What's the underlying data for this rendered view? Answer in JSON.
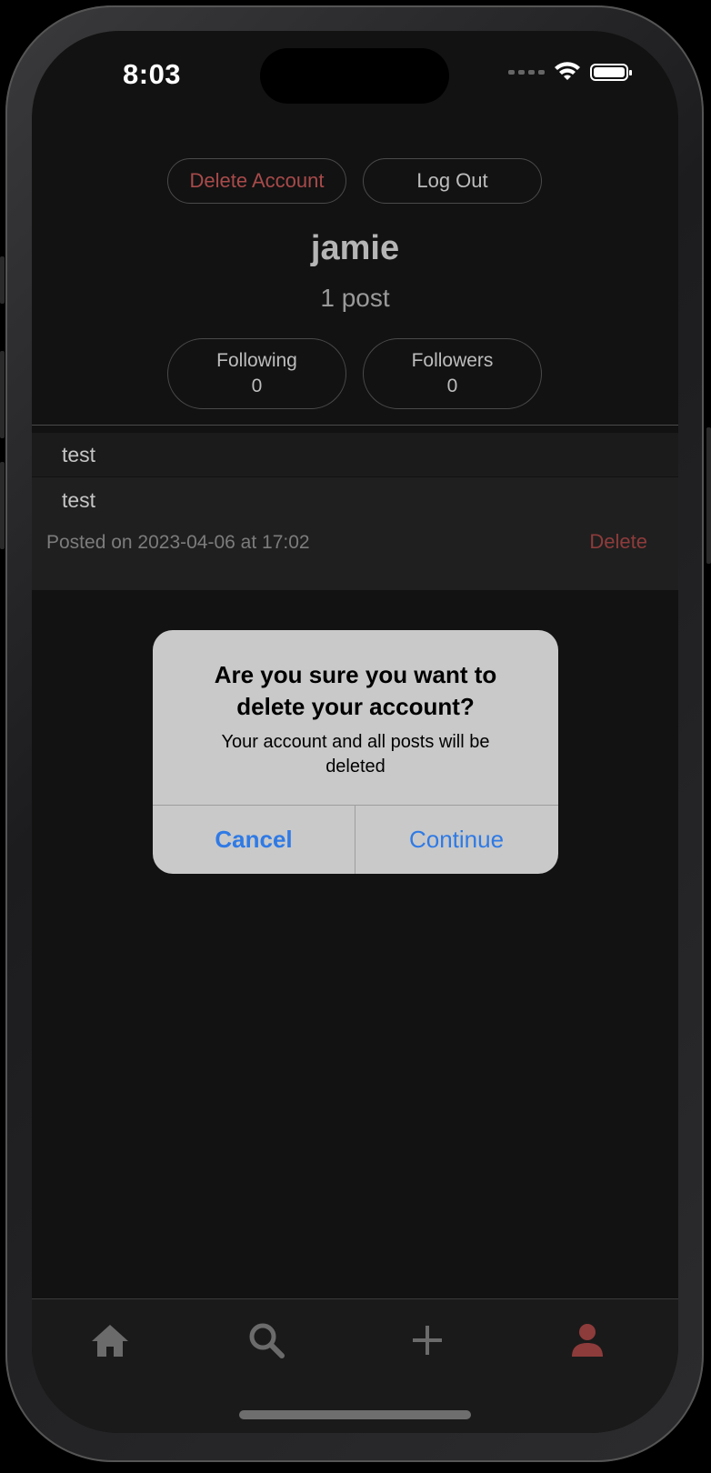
{
  "status_bar": {
    "time": "8:03"
  },
  "header": {
    "delete_account_label": "Delete Account",
    "log_out_label": "Log Out",
    "username": "jamie",
    "post_count": "1 post"
  },
  "stats": {
    "following_label": "Following",
    "following_count": "0",
    "followers_label": "Followers",
    "followers_count": "0"
  },
  "post": {
    "title": "test",
    "body": "test",
    "meta": "Posted on 2023-04-06 at 17:02",
    "delete_label": "Delete"
  },
  "alert": {
    "title": "Are you sure you want to delete your account?",
    "message": "Your account and all posts will be deleted",
    "cancel_label": "Cancel",
    "continue_label": "Continue"
  },
  "tab_bar": {
    "tabs": [
      {
        "icon": "home-icon"
      },
      {
        "icon": "search-icon"
      },
      {
        "icon": "plus-icon"
      },
      {
        "icon": "person-icon",
        "active": true
      }
    ]
  },
  "colors": {
    "destructive": "#a84a4a",
    "link": "#2f7ae5",
    "active_tab": "#a84a4a"
  }
}
